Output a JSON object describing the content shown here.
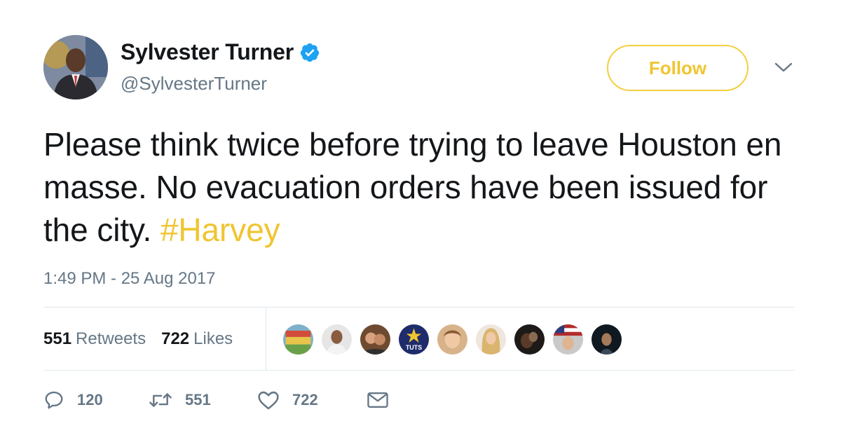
{
  "user": {
    "name": "Sylvester Turner",
    "handle": "@SylvesterTurner",
    "verified": true
  },
  "follow_button": {
    "label": "Follow"
  },
  "tweet": {
    "text": "Please think twice before trying to leave Houston en masse. No evacuation orders have been issued for the city.",
    "hashtag": "#Harvey",
    "timestamp": "1:49 PM - 25 Aug 2017"
  },
  "stats": {
    "retweets": {
      "count": "551",
      "label": "Retweets"
    },
    "likes": {
      "count": "722",
      "label": "Likes"
    },
    "likers": [
      {
        "icon": "sign-avatar"
      },
      {
        "icon": "man-avatar"
      },
      {
        "icon": "couple-avatar"
      },
      {
        "icon": "tuts-logo-avatar",
        "text": "TUTS"
      },
      {
        "icon": "woman-avatar"
      },
      {
        "icon": "blonde-woman-avatar"
      },
      {
        "icon": "dark-photo-avatar"
      },
      {
        "icon": "flag-cap-avatar"
      },
      {
        "icon": "dark-woman-avatar"
      }
    ]
  },
  "actions": {
    "reply": {
      "icon": "reply-icon",
      "count": "120"
    },
    "retweet": {
      "icon": "retweet-icon",
      "count": "551"
    },
    "like": {
      "icon": "heart-icon",
      "count": "722"
    },
    "message": {
      "icon": "envelope-icon"
    }
  },
  "colors": {
    "accent": "#f0c530",
    "text": "#14171a",
    "secondary": "#657786",
    "verified": "#1da1f2",
    "divider": "#e1e8ed"
  }
}
